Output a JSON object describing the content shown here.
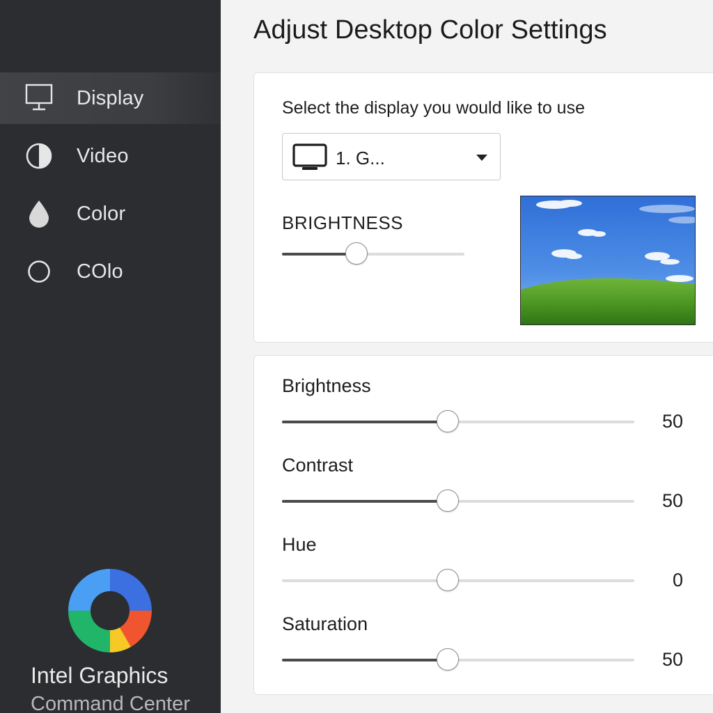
{
  "page_title": "Adjust Desktop Color Settings",
  "sidebar": {
    "items": [
      {
        "label": "Display",
        "icon": "monitor-icon",
        "active": true
      },
      {
        "label": "Video",
        "icon": "half-circle-icon",
        "active": false
      },
      {
        "label": "Color",
        "icon": "droplet-icon",
        "active": false
      },
      {
        "label": "COlo",
        "icon": "circle-outline-icon",
        "active": false
      }
    ],
    "brand": {
      "line1": "Intel Graphics",
      "line2": "Command Center",
      "logo_icon": "ring-logo-icon"
    }
  },
  "display_card": {
    "select_label": "Select the display you would like to use",
    "selected_display": "1. G...",
    "brightness_label": "BRIGHTNESS",
    "brightness_level": 0.41,
    "preview_icon": "desktop-wallpaper-preview"
  },
  "adjustments": [
    {
      "label": "Brightness",
      "value": "50",
      "level": 0.47,
      "filled": true
    },
    {
      "label": "Contrast",
      "value": "50",
      "level": 0.47,
      "filled": true
    },
    {
      "label": "Hue",
      "value": "0",
      "level": 0.47,
      "filled": false
    },
    {
      "label": "Saturation",
      "value": "50",
      "level": 0.47,
      "filled": true
    }
  ],
  "colors": {
    "sidebar_bg": "#2b2d30",
    "active_item_bg": "#414347",
    "slider_fill": "#4a4a4a",
    "slider_track": "#dcdcdc",
    "logo_blue_light": "#4a9ff5",
    "logo_blue_dark": "#3c6fe0",
    "logo_green": "#21b56a",
    "logo_yellow": "#f6c926",
    "logo_red": "#f0552f"
  }
}
